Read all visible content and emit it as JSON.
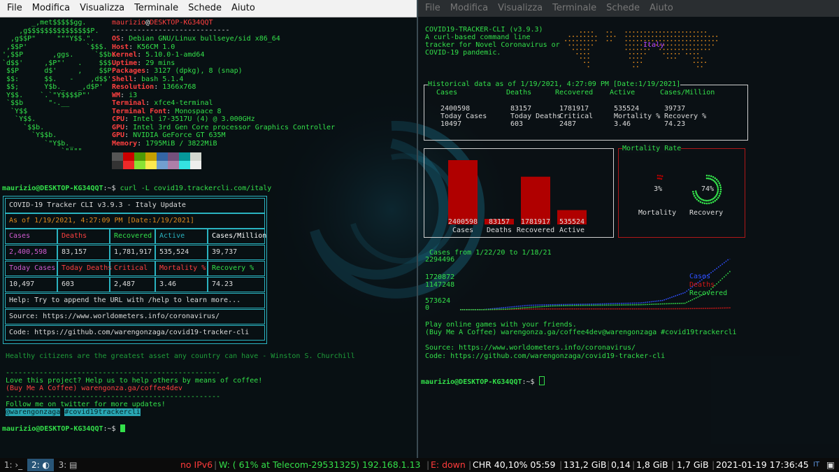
{
  "menu": [
    "File",
    "Modifica",
    "Visualizza",
    "Terminale",
    "Schede",
    "Aiuto"
  ],
  "neofetch": {
    "ascii": [
      "       _,met$$$$$gg.",
      "    ,g$$$$$$$$$$$$$$$P.",
      "  ,g$$P\"     \"\"\"Y$$.\".",
      " ,$$P'              `$$$.",
      "',$$P       ,ggs.     `$$b:",
      "`d$$'     ,$P\"'   .    $$$",
      " $$P      d$'     ,    $$P",
      " $$:      $$.   -    ,d$$'",
      " $$;      Y$b._   _,d$P'",
      " Y$$.    `.`\"Y$$$$P\"'",
      " `$$b      \"-.__",
      "  `Y$$",
      "   `Y$$.",
      "     `$$b.",
      "       `Y$$b.",
      "          `\"Y$b._",
      "              `\"\"\"\""
    ],
    "user": "maurizio",
    "host": "DESKTOP-KG34QQT",
    "separator": "----------------------------",
    "rows": [
      {
        "k": "OS",
        "v": "Debian GNU/Linux bullseye/sid x86_64"
      },
      {
        "k": "Host",
        "v": "K56CM 1.0"
      },
      {
        "k": "Kernel",
        "v": "5.10.0-1-amd64"
      },
      {
        "k": "Uptime",
        "v": "29 mins"
      },
      {
        "k": "Packages",
        "v": "3127 (dpkg), 8 (snap)"
      },
      {
        "k": "Shell",
        "v": "bash 5.1.4"
      },
      {
        "k": "Resolution",
        "v": "1366x768"
      },
      {
        "k": "WM",
        "v": "i3"
      },
      {
        "k": "Terminal",
        "v": "xfce4-terminal"
      },
      {
        "k": "Terminal Font",
        "v": "Monospace 8"
      },
      {
        "k": "CPU",
        "v": "Intel i7-3517U (4) @ 3.000GHz"
      },
      {
        "k": "GPU",
        "v": "Intel 3rd Gen Core processor Graphics Controller"
      },
      {
        "k": "GPU",
        "v": "NVIDIA GeForce GT 635M"
      },
      {
        "k": "Memory",
        "v": "1795MiB / 3822MiB"
      }
    ],
    "swatches": [
      "#555555",
      "#cc0000",
      "#4e9a06",
      "#c4a000",
      "#3465a4",
      "#75507b",
      "#06989a",
      "#d3d7cf",
      "#333333",
      "#ef2929",
      "#8ae234",
      "#fce94f",
      "#729fcf",
      "#ad7fa8",
      "#34e2e2",
      "#eeeeec"
    ]
  },
  "left": {
    "prompt": "maurizio@DESKTOP-KG34QQT",
    "prompt_suffix": ":~$ ",
    "command": "curl -L covid19.trackercli.com/italy",
    "table": {
      "title": "COVID-19 Tracker CLI v3.9.3 - Italy Update",
      "asof": "As of 1/19/2021, 4:27:09 PM [Date:1/19/2021]",
      "h1": [
        "Cases",
        "Deaths",
        "Recovered",
        "Active",
        "Cases/Million"
      ],
      "r1": [
        "2,400,598",
        "83,157",
        "1,781,917",
        "535,524",
        "39,737"
      ],
      "h2": [
        "Today Cases",
        "Today Deaths",
        "Critical",
        "Mortality %",
        "Recovery %"
      ],
      "r2": [
        "10,497",
        "603",
        "2,487",
        "3.46",
        "74.23"
      ],
      "help": "Help: Try to append the URL with /help to learn more...",
      "source": "Source: https://www.worldometers.info/coronavirus/",
      "code": "Code: https://github.com/warengonzaga/covid19-tracker-cli"
    },
    "quote": "Healthy citizens are the greatest asset any country can have - Winston S. Churchill",
    "dashes": "---------------------------------------------------",
    "love": "Love this project? Help us to help others by means of coffee!",
    "coffee": "(Buy Me A Coffee) warengonza.ga/coffee4dev",
    "follow": "Follow me on twitter for more updates!",
    "handle1": "@warengonzaga",
    "handle2": "#covid19trackercli",
    "prompt2": "maurizio@DESKTOP-KG34QQT",
    "prompt2_suffix": ":~$ "
  },
  "right": {
    "header": [
      "COVID19-TRACKER-CLI (v3.9.3)",
      "A curl-based command line",
      "tracker for Novel Coronavirus or",
      "COVID-19 pandemic."
    ],
    "map_label": "Italy",
    "hist_title": "Historical data as of 1/19/2021, 4:27:09 PM [Date:1/19/2021]",
    "hist_h1": [
      "Cases",
      "Deaths",
      "Recovered",
      "Active",
      "Cases/Million"
    ],
    "hist_r1": [
      "2400598",
      "83157",
      "1781917",
      "535524",
      "39737"
    ],
    "hist_h2": [
      "Today Cases",
      "Today Deaths",
      "Critical",
      "Mortality %",
      "Recovery %"
    ],
    "hist_r2": [
      "10497",
      "603",
      "2487",
      "3.46",
      "74.23"
    ],
    "mortality_title": "Mortality Rate",
    "mortality_pct": "3%",
    "recovery_pct": "74%",
    "mortality_label": "Mortality",
    "recovery_label": "Recovery",
    "line_title": "Cases from 1/22/20 to 1/18/21",
    "line_yticks": [
      "2294496",
      "1720872",
      "1147248",
      "573624",
      "0"
    ],
    "legend": [
      "Cases",
      "Deaths",
      "Recovered"
    ],
    "games": "Play online games with your friends.",
    "coffee": "(Buy Me A Coffee) warengonza.ga/coffee4dev@warengonzaga #covid19trackercli",
    "source": "Source: https://www.worldometers.info/coronavirus/",
    "code": "Code: https://github.com/warengonzaga/covid19-tracker-cli",
    "prompt": "maurizio@DESKTOP-KG34QQT",
    "prompt_suffix": ":~$ "
  },
  "chart_data": [
    {
      "type": "bar",
      "categories": [
        "Cases",
        "Deaths",
        "Recovered",
        "Active"
      ],
      "values": [
        2400598,
        83157,
        1781917,
        535524
      ],
      "title": "",
      "xlabel": "",
      "ylabel": ""
    },
    {
      "type": "pie",
      "title": "Mortality Rate",
      "categories": [
        "Mortality",
        "Recovery"
      ],
      "values": [
        3,
        74
      ]
    },
    {
      "type": "line",
      "title": "Cases from 1/22/20 to 1/18/21",
      "ylim": [
        0,
        2294496
      ],
      "yticks": [
        0,
        573624,
        1147248,
        1720872,
        2294496
      ],
      "series": [
        {
          "name": "Cases",
          "values": [
            0,
            500,
            100000,
            200000,
            230000,
            245000,
            260000,
            290000,
            310000,
            430000,
            800000,
            1600000,
            2400598
          ]
        },
        {
          "name": "Deaths",
          "values": [
            0,
            20,
            12000,
            28000,
            33000,
            35000,
            35000,
            35500,
            36000,
            37000,
            45000,
            60000,
            83157
          ]
        },
        {
          "name": "Recovered",
          "values": [
            0,
            0,
            20000,
            100000,
            170000,
            195000,
            205000,
            215000,
            230000,
            270000,
            300000,
            800000,
            1781917
          ]
        }
      ]
    }
  ],
  "status": {
    "workspaces": [
      {
        "num": "1:",
        "icon": "terminal-icon",
        "glyph": "›_"
      },
      {
        "num": "2:",
        "icon": "debian-icon",
        "glyph": "◐"
      },
      {
        "num": "3:",
        "icon": "menu-icon",
        "glyph": "▤"
      }
    ],
    "ipv6": "no IPv6",
    "wifi": "W: ( 61% at Telecom-29531325) 192.168.1.13",
    "eth": "E: down",
    "battery": "CHR 40,10% 05:59",
    "disk": "131,2 GiB",
    "load": "0,14",
    "mem1": "1,8 GiB",
    "mem2": "1,7 GiB",
    "datetime": "2021-01-19 17:36:45",
    "layout": "IT",
    "colors": {
      "red": "#ff3b3b",
      "green": "#33e04a",
      "white": "#ffffff"
    }
  }
}
